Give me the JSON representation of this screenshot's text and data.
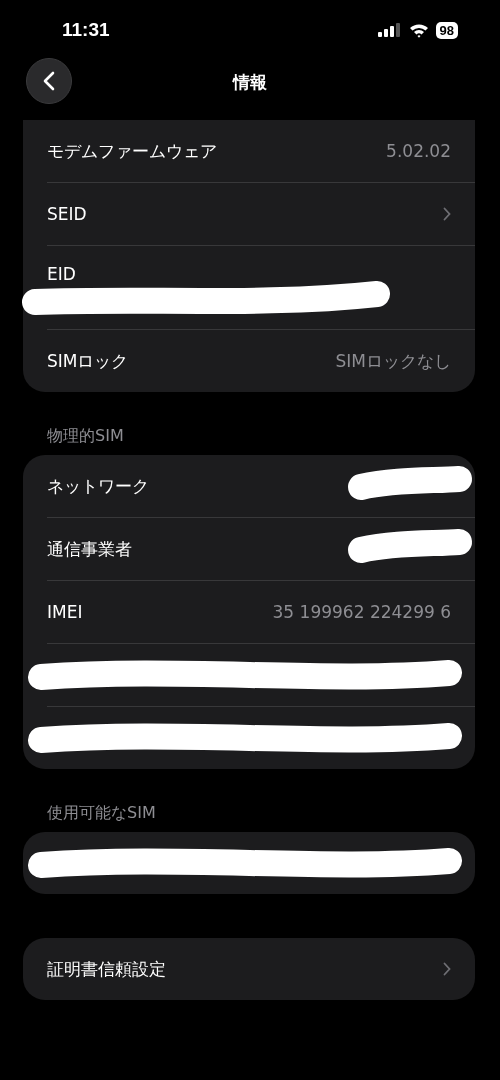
{
  "status_bar": {
    "time": "11:31",
    "battery": "98"
  },
  "nav": {
    "title": "情報"
  },
  "sections": [
    {
      "rows": [
        {
          "kind": "detail",
          "label": "モデムファームウェア",
          "value": "5.02.02"
        },
        {
          "kind": "link",
          "label": "SEID"
        },
        {
          "kind": "redacted_below",
          "label": "EID"
        },
        {
          "kind": "detail",
          "label": "SIMロック",
          "value": "SIMロックなし"
        }
      ]
    },
    {
      "header": "物理的SIM",
      "rows": [
        {
          "kind": "redacted_value",
          "label": "ネットワーク"
        },
        {
          "kind": "redacted_value",
          "label": "通信事業者"
        },
        {
          "kind": "detail",
          "label": "IMEI",
          "value": "35 199962 224299 6"
        },
        {
          "kind": "redacted_row"
        },
        {
          "kind": "redacted_row"
        }
      ]
    },
    {
      "header": "使用可能なSIM",
      "rows": [
        {
          "kind": "redacted_row"
        }
      ]
    },
    {
      "rows": [
        {
          "kind": "link",
          "label": "証明書信頼設定"
        }
      ]
    }
  ]
}
